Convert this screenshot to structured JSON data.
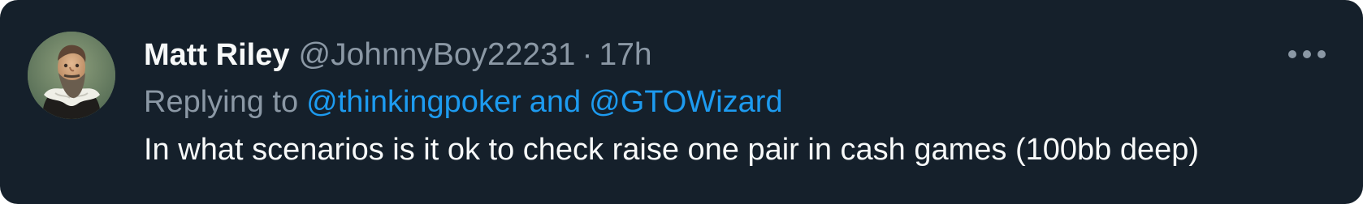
{
  "tweet": {
    "author": {
      "display_name": "Matt Riley",
      "handle": "@JohnnyBoy22231"
    },
    "separator": "·",
    "time": "17h",
    "reply": {
      "prefix": "Replying to",
      "mentions": [
        "@thinkingpoker",
        "@GTOWizard"
      ],
      "conjunction": "and"
    },
    "text": "In what scenarios is it ok to check raise one pair in cash games (100bb deep)",
    "more_icon": "more-horizontal-icon"
  },
  "colors": {
    "background": "#15202b",
    "primary_text": "#f7f9f9",
    "secondary_text": "#8b98a5",
    "accent": "#1d9bf0"
  }
}
